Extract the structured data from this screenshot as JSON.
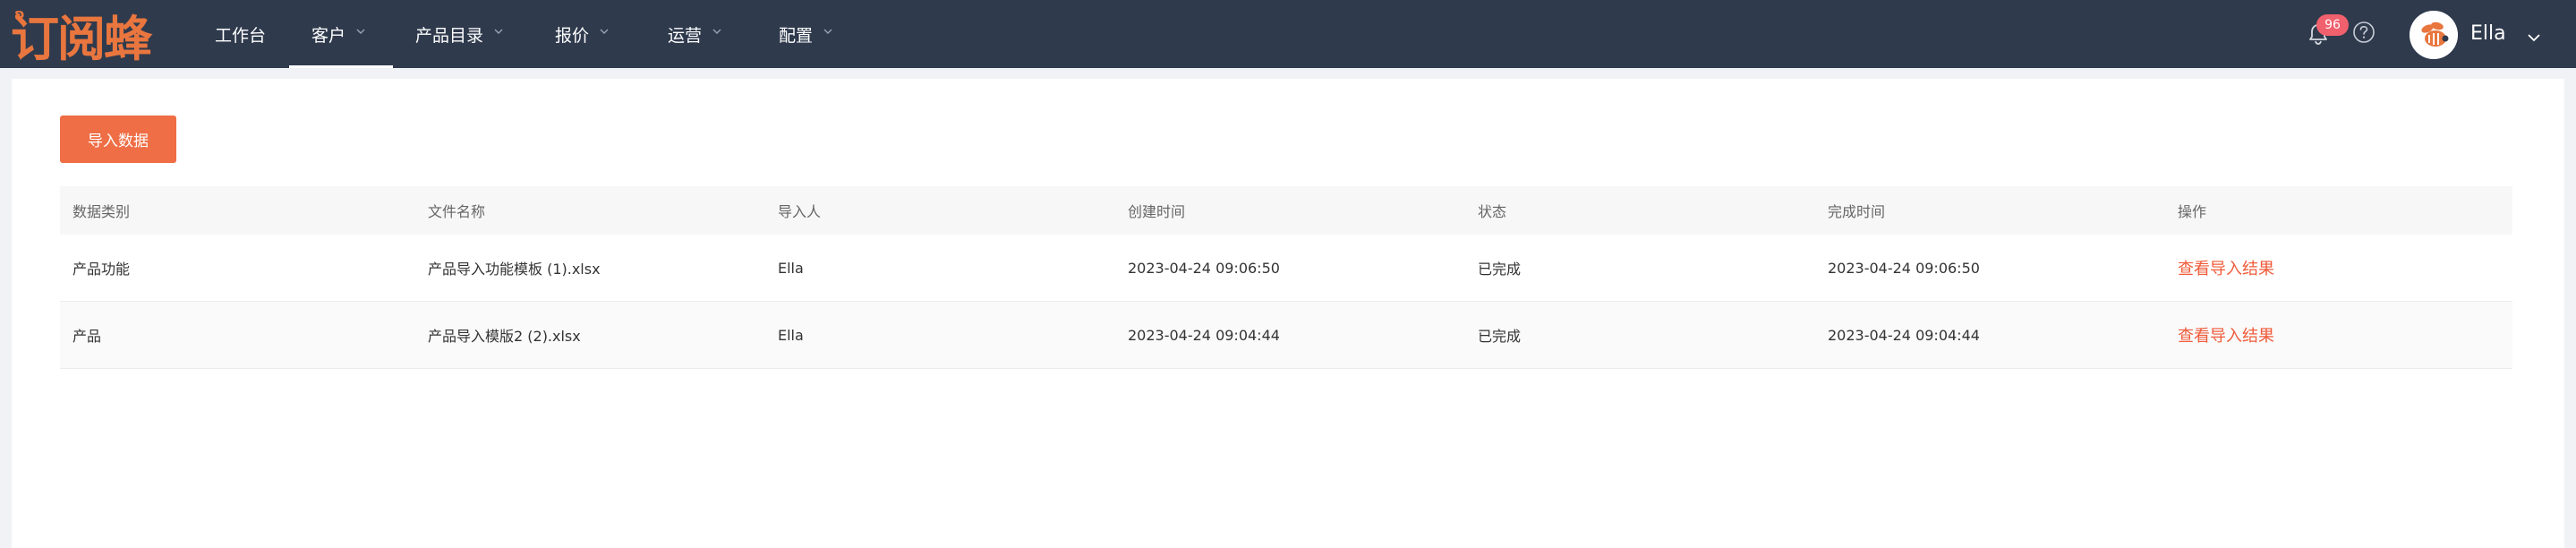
{
  "app": {
    "logo_text": "订阅蜂",
    "brand_color": "#e8763e",
    "accent_color": "#ef6e45",
    "link_color": "#ef5b3a",
    "header_bg": "#2f3a4d"
  },
  "nav": {
    "items": [
      {
        "label": "工作台",
        "has_dropdown": false,
        "active": false
      },
      {
        "label": "客户",
        "has_dropdown": true,
        "active": true
      },
      {
        "label": "产品目录",
        "has_dropdown": true,
        "active": false
      },
      {
        "label": "报价",
        "has_dropdown": true,
        "active": false
      },
      {
        "label": "运营",
        "has_dropdown": true,
        "active": false
      },
      {
        "label": "配置",
        "has_dropdown": true,
        "active": false
      }
    ]
  },
  "header_tools": {
    "notification_count": "96",
    "bell_icon": "bell-icon",
    "help_icon": "help-circle-icon",
    "user_name": "Ella"
  },
  "toolbar": {
    "import_label": "导入数据"
  },
  "table": {
    "columns": [
      "数据类别",
      "文件名称",
      "导入人",
      "创建时间",
      "状态",
      "完成时间",
      "操作"
    ],
    "rows": [
      {
        "category": "产品功能",
        "file_name": "产品导入功能模板 (1).xlsx",
        "importer": "Ella",
        "created_at": "2023-04-24 09:06:50",
        "status": "已完成",
        "completed_at": "2023-04-24 09:06:50",
        "action": "查看导入结果"
      },
      {
        "category": "产品",
        "file_name": "产品导入模版2 (2).xlsx",
        "importer": "Ella",
        "created_at": "2023-04-24 09:04:44",
        "status": "已完成",
        "completed_at": "2023-04-24 09:04:44",
        "action": "查看导入结果"
      }
    ]
  }
}
